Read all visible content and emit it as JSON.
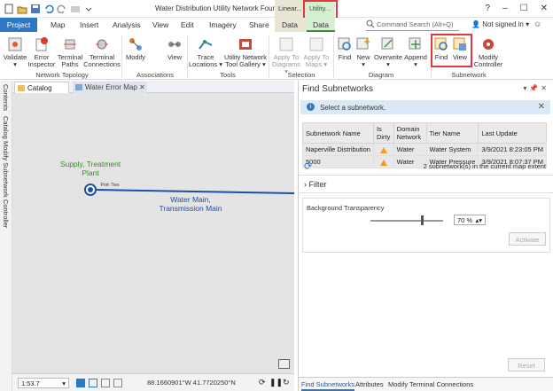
{
  "window": {
    "title": "Water Distribution Utility Network Foundatio...",
    "context_linear": "Linear...",
    "context_utility": "Utility..."
  },
  "tabs": [
    {
      "label": "Project"
    },
    {
      "label": "Map"
    },
    {
      "label": "Insert"
    },
    {
      "label": "Analysis"
    },
    {
      "label": "View"
    },
    {
      "label": "Edit"
    },
    {
      "label": "Imagery"
    },
    {
      "label": "Share"
    },
    {
      "label": "Data"
    },
    {
      "label": "Data"
    }
  ],
  "search": {
    "placeholder": "Command Search (Alt+Q)"
  },
  "account": {
    "label": "Not signed in"
  },
  "ribbon": {
    "validate": "Validate",
    "error_inspector": "Error Inspector",
    "terminal_paths": "Terminal Paths",
    "terminal_connections": "Terminal Connections",
    "modify": "Modify",
    "view": "View",
    "trace_locations": "Trace Locations",
    "un_tool_gallery": "Utility Network Tool Gallery",
    "apply_diagrams": "Apply To Diagrams",
    "apply_maps": "Apply To Maps",
    "find": "Find",
    "new": "New",
    "overwrite": "Overwrite",
    "append": "Append",
    "sub_find": "Find",
    "sub_view": "View",
    "modify_controller": "Modify Controller",
    "groups": {
      "network_topology": "Network Topology",
      "associations": "Associations",
      "tools": "Tools",
      "selection": "Selection",
      "diagram": "Diagram",
      "subnetwork": "Subnetwork"
    }
  },
  "side": {
    "contents": "Contents",
    "catalog": "Catalog",
    "modify_subnet": "Modify Subnetwork Controller"
  },
  "map_tabs": {
    "catalog": "Catalog",
    "water": "Water Error Map"
  },
  "map": {
    "supply_label": "Supply, Treatment Plant",
    "port_label": "Port: Two",
    "main_label": "Water Main, Transmission Main"
  },
  "status": {
    "scale": "1:53.7",
    "coords": "88.1660901°W 41.7720250°N"
  },
  "pane": {
    "title": "Find Subnetworks",
    "info": "Select a subnetwork.",
    "columns": [
      "Subnetwork Name",
      "Is Dirty",
      "Domain Network",
      "Tier Name",
      "Last Update"
    ],
    "rows": [
      {
        "name": "Naperville Distribution",
        "domain": "Water",
        "tier": "Water System",
        "update": "3/9/2021 8:23:05 PM"
      },
      {
        "name": "5000",
        "domain": "Water",
        "tier": "Water Pressure",
        "update": "3/9/2021 8:07:37 PM"
      }
    ],
    "count": "2 subnetwork(s) in the current map extent",
    "filter": "Filter",
    "bg_label": "Background Transparency",
    "bg_value": "70 %",
    "bg_fraction": 0.7,
    "activate": "Activate",
    "reset": "Reset"
  },
  "bottom_tabs": [
    "Find Subnetworks",
    "Attributes",
    "Modify Terminal Connections"
  ],
  "colors": {
    "project_tab": "#2b79c2",
    "utility_ctx": "#d6efd0",
    "linear_ctx": "#e9e5d4",
    "highlight": "#e0393e",
    "main_line": "#1f4fa0",
    "supply_text": "#3a8a2a"
  }
}
